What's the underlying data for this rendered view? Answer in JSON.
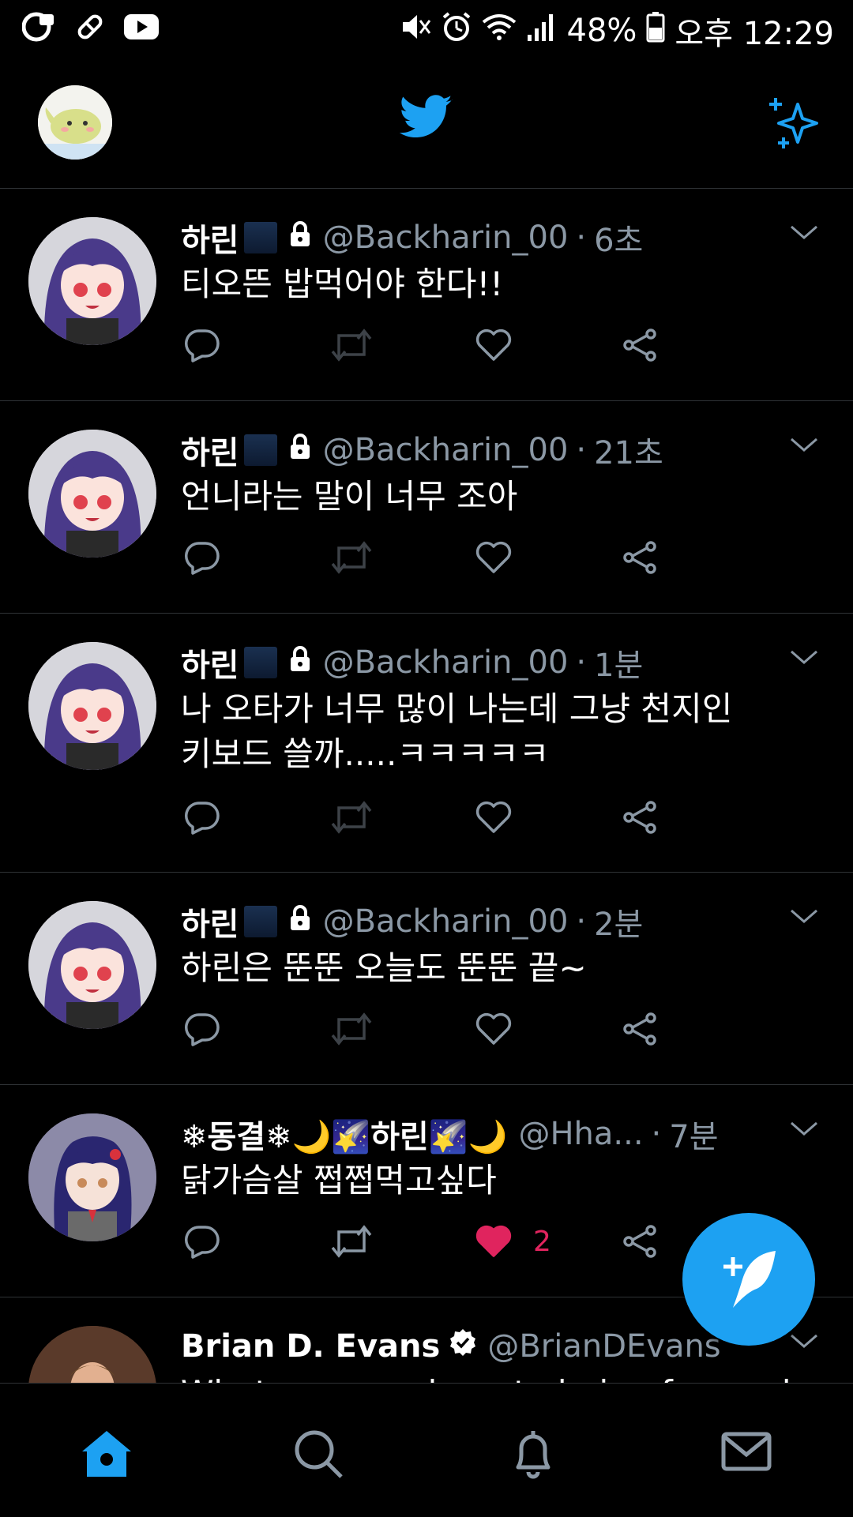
{
  "status_bar": {
    "battery": "48%",
    "time": "오후 12:29",
    "left_icons": [
      "u-plus-icon",
      "pill-icon",
      "youtube-icon"
    ],
    "right_icons": [
      "mute-icon",
      "alarm-icon",
      "wifi-icon",
      "signal-icon",
      "battery-icon"
    ]
  },
  "header": {
    "logo": "twitter-bird-icon",
    "right_icon": "sparkle-icon"
  },
  "colors": {
    "accent": "#1da1f2",
    "like": "#e0245e",
    "muted": "#8b98a5",
    "background": "#000000"
  },
  "tweets": [
    {
      "name": "하린",
      "handle": "@Backharin_00",
      "time": "6초",
      "text": "티오뜬 밥먹어야 한다!!",
      "liked": false,
      "like_count": ""
    },
    {
      "name": "하린",
      "handle": "@Backharin_00",
      "time": "21초",
      "text": "언니라는 말이 너무 조아",
      "liked": false,
      "like_count": ""
    },
    {
      "name": "하린",
      "handle": "@Backharin_00",
      "time": "1분",
      "text": "나 오타가 너무 많이 나는데 그냥 천지인 키보드 쓸까.....ㅋㅋㅋㅋㅋ",
      "liked": false,
      "like_count": ""
    },
    {
      "name": "하린",
      "handle": "@Backharin_00",
      "time": "2분",
      "text": "하린은 뚠뚠 오늘도 뚠뚠 끝~",
      "liked": false,
      "like_count": ""
    },
    {
      "name": "❄동결❄🌙🌠하린🌠🌙",
      "handle": "@Hha...",
      "time": "7분",
      "text": "닭가슴살 쩝쩝먹고싶다",
      "liked": true,
      "like_count": "2"
    },
    {
      "name": "Brian D. Evans",
      "handle": "@BrianDEvans",
      "time": "",
      "text": "What are your keys to being focused and",
      "liked": false,
      "like_count": ""
    }
  ],
  "fab": {
    "icon": "compose-tweet-icon"
  },
  "bottom_nav": {
    "items": [
      "home-icon",
      "search-icon",
      "notifications-icon",
      "messages-icon"
    ],
    "active": "home-icon"
  }
}
